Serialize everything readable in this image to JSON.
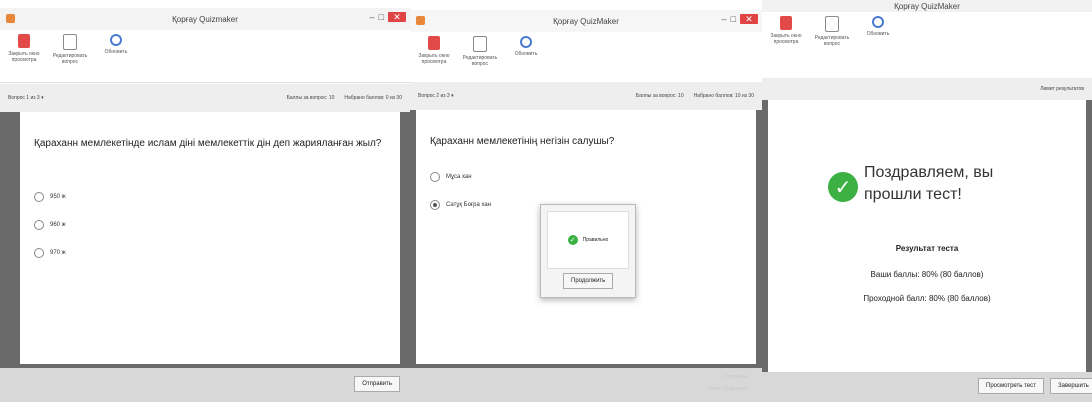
{
  "window1": {
    "title": "Қорғау Quizmaker",
    "ribbon": [
      {
        "label": "Закрыть окно просмотра",
        "icon": "close-doc-icon"
      },
      {
        "label": "Редактировать вопрос",
        "icon": "edit-doc-icon"
      },
      {
        "label": "Обновить",
        "icon": "refresh-icon"
      }
    ],
    "question_selector": "Вопрос 1 из 3 ▾",
    "points_label": "Баллы за вопрос: 10",
    "score_label": "Набрано баллов: 0 из 30",
    "question": "Қараханн мемлекетінде ислам дінi мемлекеттік дін деп жарияланған жыл?",
    "options": [
      "950 ж",
      "960 ж",
      "970 ж"
    ],
    "submit_button": "Отправить"
  },
  "window2": {
    "title": "Қорғау QuizMaker",
    "ribbon": [
      {
        "label": "Закрыть окно просмотра",
        "icon": "close-doc-icon"
      },
      {
        "label": "Редактировать вопрос",
        "icon": "edit-doc-icon"
      },
      {
        "label": "Обновить",
        "icon": "refresh-icon"
      }
    ],
    "question_selector": "Вопрос 2 из 3 ▾",
    "points_label": "Баллы за вопрос: 10",
    "score_label": "Набрано баллов: 10 из 30",
    "question": "Қараханн мемлекетінің негізін салушы?",
    "options": [
      "Мұса хан",
      "Сатұқ Боғра хан"
    ],
    "selected_option": 1,
    "popup_text": "Правильно",
    "popup_button": "Продолжить",
    "faint_lines": [
      "Отправить",
      "Ответ отправлен"
    ]
  },
  "window3": {
    "title": "Қорғау QuizMaker",
    "ribbon": [
      {
        "label": "Закрыть окно просмотра",
        "icon": "close-doc-icon"
      },
      {
        "label": "Редактировать вопрос",
        "icon": "edit-doc-icon"
      },
      {
        "label": "Обновить",
        "icon": "refresh-icon"
      }
    ],
    "header_right": "Лимит результатов",
    "congrats": "Поздравляем, вы прошли тест!",
    "result_title": "Результат теста",
    "your_score": "Ваши баллы: 80% (80 баллов)",
    "passing_score": "Проходной балл: 80% (80 баллов)",
    "review_button": "Просмотреть тест",
    "finish_button": "Завершить"
  }
}
